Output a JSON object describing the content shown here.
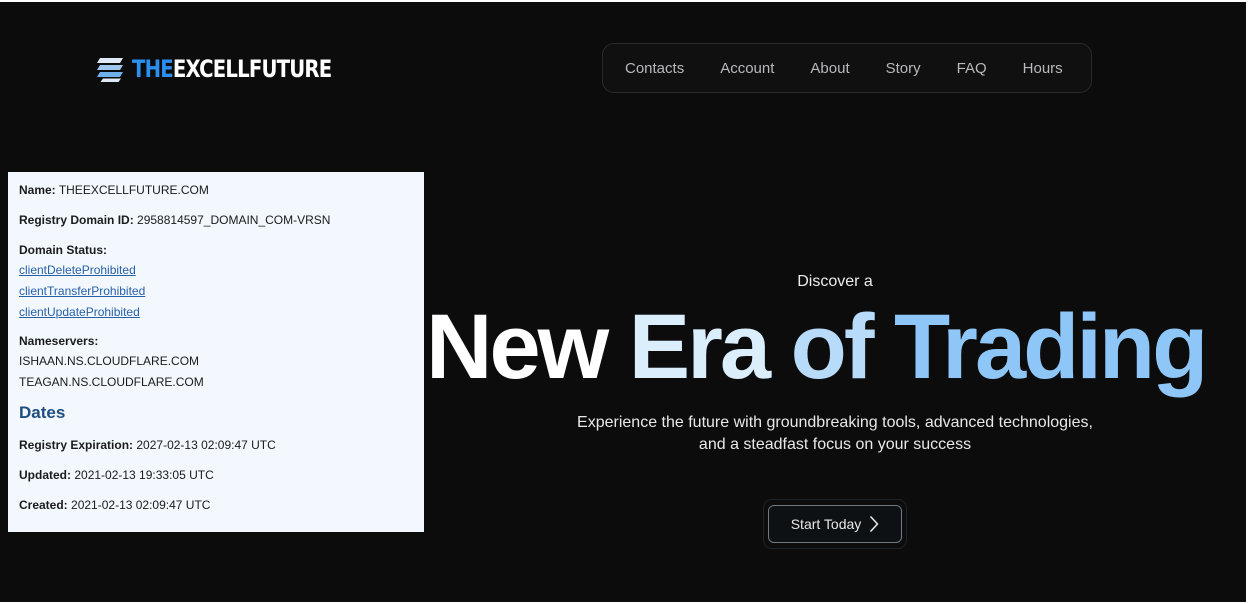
{
  "brand": {
    "logo_prefix": "THE",
    "logo_name": "EXCELLFUTURE",
    "accent_color": "#2c8ff0"
  },
  "nav": {
    "items": [
      "Contacts",
      "Account",
      "About",
      "Story",
      "FAQ",
      "Hours"
    ]
  },
  "whois": {
    "name_label": "Name:",
    "name_value": "THEEXCELLFUTURE.COM",
    "registry_id_label": "Registry Domain ID:",
    "registry_id_value": "2958814597_DOMAIN_COM-VRSN",
    "status_label": "Domain Status:",
    "statuses": [
      "clientDeleteProhibited",
      "clientTransferProhibited",
      "clientUpdateProhibited"
    ],
    "nameservers_label": "Nameservers:",
    "nameservers": [
      "ISHAAN.NS.CLOUDFLARE.COM",
      "TEAGAN.NS.CLOUDFLARE.COM"
    ],
    "dates_heading": "Dates",
    "expiration_label": "Registry Expiration:",
    "expiration_value": "2027-02-13 02:09:47 UTC",
    "updated_label": "Updated:",
    "updated_value": "2021-02-13 19:33:05 UTC",
    "created_label": "Created:",
    "created_value": "2021-02-13 02:09:47 UTC"
  },
  "hero": {
    "eyebrow": "Discover a",
    "title_part1": "New ",
    "title_part2": "Era ",
    "title_part3": "of ",
    "title_part4": "Trading",
    "subtitle_line1": "Experience the future with groundbreaking tools, advanced technologies,",
    "subtitle_line2": "and a steadfast focus on your success",
    "cta_label": "Start Today",
    "cta_icon": "chevron-right-icon"
  }
}
